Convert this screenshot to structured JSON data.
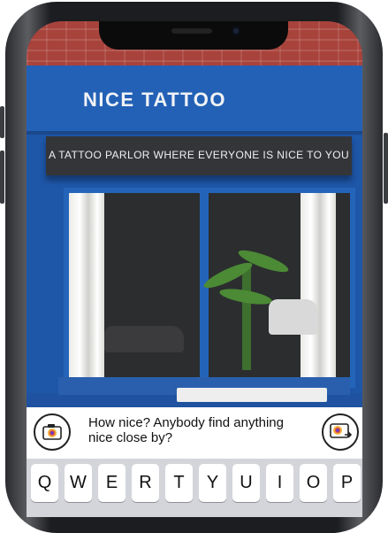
{
  "storefront": {
    "sign": "NICE TATTOO",
    "awning": "A TATTOO PARLOR WHERE EVERYONE IS NICE TO YOU"
  },
  "message": {
    "text": "How nice? Anybody find anything nice close by?",
    "left_icon": "camera-icon",
    "right_icon": "send-photo-icon"
  },
  "keyboard": {
    "row1": [
      "Q",
      "W",
      "E",
      "R",
      "T",
      "Y",
      "U",
      "I",
      "O",
      "P"
    ]
  },
  "colors": {
    "facade_blue": "#1e56a8",
    "awning": "#333539",
    "keyboard_bg": "#d3d5db"
  }
}
